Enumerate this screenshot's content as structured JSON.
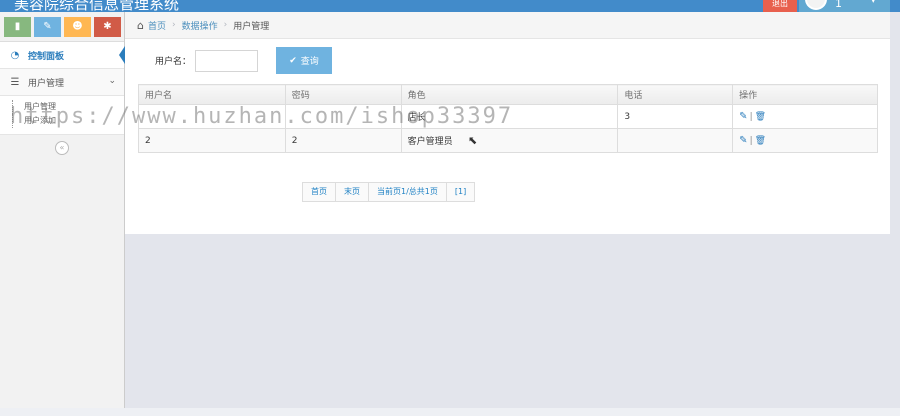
{
  "header": {
    "title": "美容院综合信息管理系统",
    "logout_label": "退出",
    "user_name": "1",
    "user_caret": "▾"
  },
  "sidebar": {
    "shortcuts": [
      {
        "icon": "signal-icon",
        "glyph": "▮",
        "color": "#87b87f"
      },
      {
        "icon": "pencil-icon",
        "glyph": "✎",
        "color": "#6fb3e0"
      },
      {
        "icon": "users-icon",
        "glyph": "☻",
        "color": "#ffb752"
      },
      {
        "icon": "cogs-icon",
        "glyph": "✱",
        "color": "#d15b47"
      }
    ],
    "dashboard_label": "控制面板",
    "dashboard_icon": "◔",
    "user_mgmt_label": "用户管理",
    "user_mgmt_icon": "☰",
    "user_mgmt_caret": "⌄",
    "sub_items": [
      {
        "label": "用户管理"
      },
      {
        "label": "用户添加"
      }
    ],
    "collapse_glyph": "«"
  },
  "breadcrumb": {
    "home_glyph": "⌂",
    "home": "首页",
    "sep": "›",
    "section": "数据操作",
    "current": "用户管理"
  },
  "search": {
    "label": "用户名：",
    "value": "",
    "button_label": "查询",
    "button_icon": "✔"
  },
  "table": {
    "headers": [
      "用户名",
      "密码",
      "角色",
      "电话",
      "操作"
    ],
    "rows": [
      {
        "username": "",
        "password": "",
        "role": "店长",
        "phone": "3"
      },
      {
        "username": "2",
        "password": "2",
        "role": "客户管理员",
        "phone": ""
      }
    ],
    "edit_glyph": "✎",
    "sep": "|",
    "delete_glyph": "🗑"
  },
  "pager": {
    "first": "首页",
    "last": "末页",
    "info": "当前页1/总共1页",
    "pages": "[1]"
  },
  "watermark": "https://www.huzhan.com/ishop33397",
  "colors": {
    "navbar": "#428bca",
    "logout": "#e8604e",
    "accent": "#2b7dbc",
    "search_button": "#6fb3e0"
  }
}
